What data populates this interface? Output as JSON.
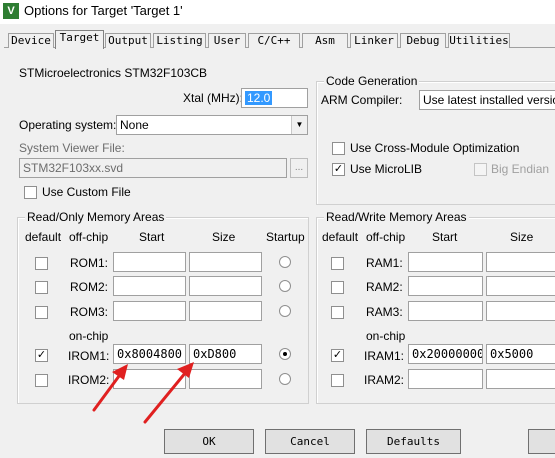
{
  "window": {
    "title": "Options for Target 'Target 1'",
    "icon_text": "V"
  },
  "tabs": [
    {
      "label": "Device"
    },
    {
      "label": "Target"
    },
    {
      "label": "Output"
    },
    {
      "label": "Listing"
    },
    {
      "label": "User"
    },
    {
      "label": "C/C++"
    },
    {
      "label": "Asm"
    },
    {
      "label": "Linker"
    },
    {
      "label": "Debug"
    },
    {
      "label": "Utilities"
    }
  ],
  "device_name": "STMicroelectronics STM32F103CB",
  "xtal": {
    "label": "Xtal (MHz):",
    "value": "12.0"
  },
  "os": {
    "label": "Operating system:",
    "value": "None"
  },
  "svd": {
    "label": "System Viewer File:",
    "value": "STM32F103xx.svd",
    "browse": "..."
  },
  "custom_file": {
    "label": "Use Custom File",
    "checked": false
  },
  "codegen": {
    "title": "Code Generation",
    "compiler_label": "ARM Compiler:",
    "compiler_value": "Use latest installed version",
    "cross_module": {
      "label": "Use Cross-Module Optimization",
      "checked": false
    },
    "microlib": {
      "label": "Use MicroLIB",
      "checked": true,
      "mark": "✓"
    },
    "big_endian": {
      "label": "Big Endian",
      "checked": false
    }
  },
  "ro_memory": {
    "title": "Read/Only Memory Areas",
    "headers": {
      "default": "default",
      "offchip": "off-chip",
      "start": "Start",
      "size": "Size",
      "startup": "Startup"
    },
    "onchip_label": "on-chip",
    "rows": [
      {
        "name": "ROM1:",
        "default": false,
        "start": "",
        "size": "",
        "startup": false
      },
      {
        "name": "ROM2:",
        "default": false,
        "start": "",
        "size": "",
        "startup": false
      },
      {
        "name": "ROM3:",
        "default": false,
        "start": "",
        "size": "",
        "startup": false
      },
      {
        "name": "IROM1:",
        "default": true,
        "start": "0x8004800",
        "size": "0xD800",
        "startup": true
      },
      {
        "name": "IROM2:",
        "default": false,
        "start": "",
        "size": "",
        "startup": false
      }
    ],
    "check_mark": "✓"
  },
  "rw_memory": {
    "title": "Read/Write Memory Areas",
    "headers": {
      "default": "default",
      "offchip": "off-chip",
      "start": "Start",
      "size": "Size"
    },
    "onchip_label": "on-chip",
    "rows": [
      {
        "name": "RAM1:",
        "default": false,
        "start": "",
        "size": ""
      },
      {
        "name": "RAM2:",
        "default": false,
        "start": "",
        "size": ""
      },
      {
        "name": "RAM3:",
        "default": false,
        "start": "",
        "size": ""
      },
      {
        "name": "IRAM1:",
        "default": true,
        "start": "0x20000000",
        "size": "0x5000"
      },
      {
        "name": "IRAM2:",
        "default": false,
        "start": "",
        "size": ""
      }
    ],
    "check_mark": "✓"
  },
  "buttons": {
    "ok": "OK",
    "cancel": "Cancel",
    "defaults": "Defaults"
  },
  "annotation_color": "#e02020"
}
